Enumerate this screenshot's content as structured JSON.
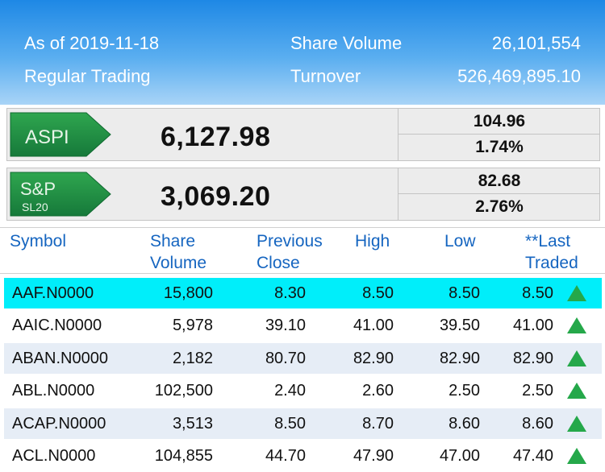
{
  "header": {
    "as_of": "As of 2019-11-18",
    "session": "Regular Trading",
    "share_volume_label": "Share Volume",
    "share_volume_value": "26,101,554",
    "turnover_label": "Turnover",
    "turnover_value": "526,469,895.10"
  },
  "indices": [
    {
      "badge_line1": "ASPI",
      "badge_line2": "",
      "value": "6,127.98",
      "change": "104.96",
      "change_pct": "1.74%"
    },
    {
      "badge_line1": "S&P",
      "badge_line2": "SL20",
      "value": "3,069.20",
      "change": "82.68",
      "change_pct": "2.76%"
    }
  ],
  "columns": {
    "symbol": "Symbol",
    "share_volume": "Share\nVolume",
    "previous_close": "Previous\nClose",
    "high": "High",
    "low": "Low",
    "last_traded": "**Last\nTraded"
  },
  "rows": [
    {
      "symbol": "AAF.N0000",
      "volume": "15,800",
      "prev": "8.30",
      "high": "8.50",
      "low": "8.50",
      "last": "8.50",
      "trend": "up-arrow-icon"
    },
    {
      "symbol": "AAIC.N0000",
      "volume": "5,978",
      "prev": "39.10",
      "high": "41.00",
      "low": "39.50",
      "last": "41.00",
      "trend": "up-arrow-icon"
    },
    {
      "symbol": "ABAN.N0000",
      "volume": "2,182",
      "prev": "80.70",
      "high": "82.90",
      "low": "82.90",
      "last": "82.90",
      "trend": "up-arrow-icon"
    },
    {
      "symbol": "ABL.N0000",
      "volume": "102,500",
      "prev": "2.40",
      "high": "2.60",
      "low": "2.50",
      "last": "2.50",
      "trend": "up-arrow-icon"
    },
    {
      "symbol": "ACAP.N0000",
      "volume": "3,513",
      "prev": "8.50",
      "high": "8.70",
      "low": "8.60",
      "last": "8.60",
      "trend": "up-arrow-icon"
    },
    {
      "symbol": "ACL.N0000",
      "volume": "104,855",
      "prev": "44.70",
      "high": "47.90",
      "low": "47.00",
      "last": "47.40",
      "trend": "up-arrow-icon"
    }
  ],
  "colors": {
    "header_top": "#1e88e5",
    "header_bottom": "#a9d4f7",
    "badge_green": "#1e8b3a",
    "column_header_text": "#1565c0",
    "highlight_row": "#00eefa",
    "alt_row": "#e6edf6",
    "up_arrow": "#25a84a"
  }
}
